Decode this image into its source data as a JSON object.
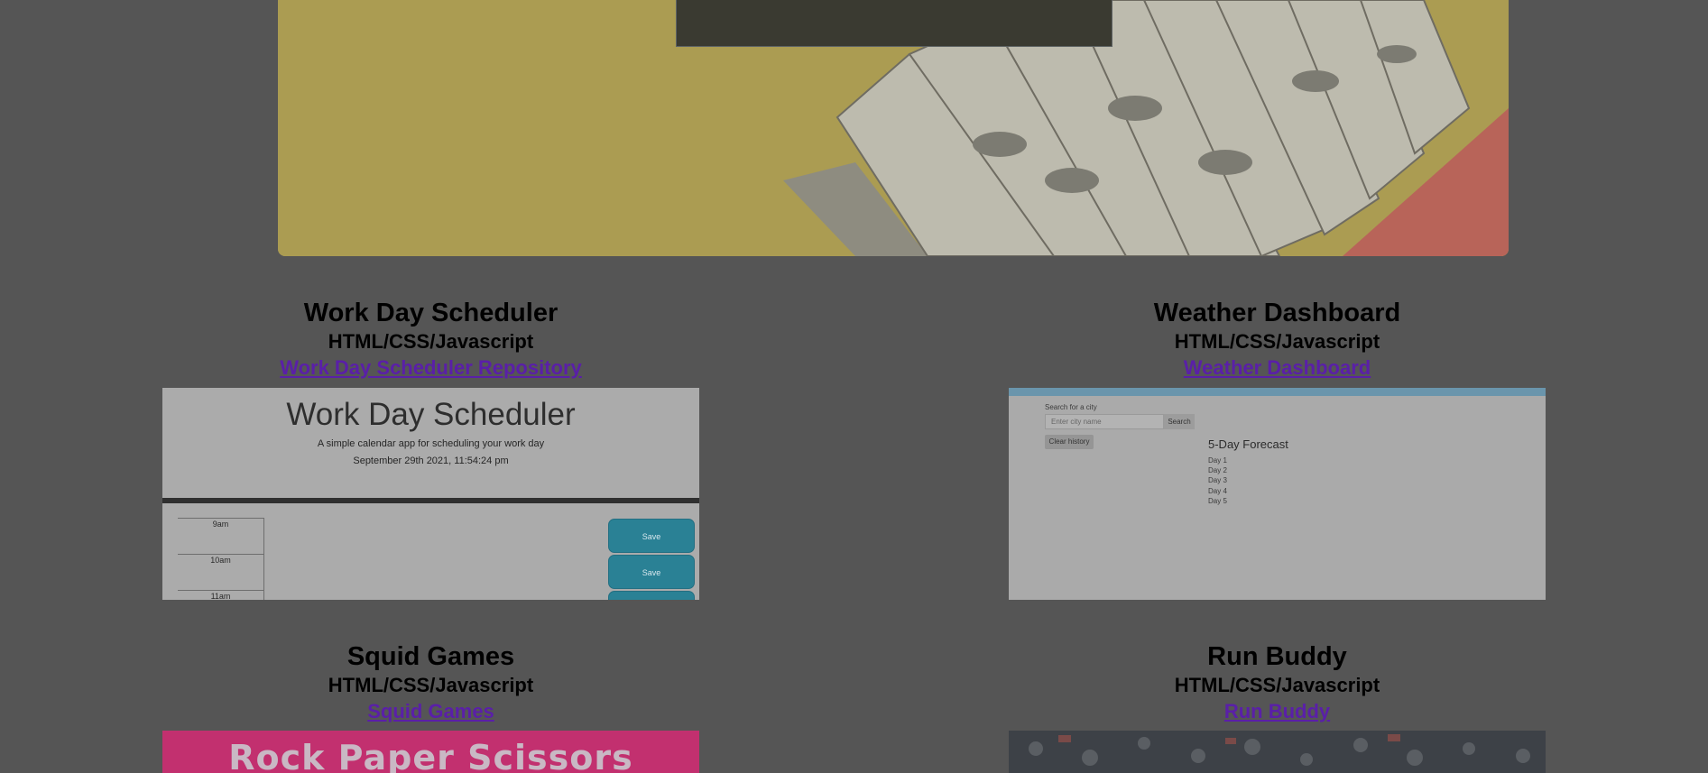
{
  "projects": [
    {
      "title": "Work Day Scheduler",
      "stack": "HTML/CSS/Javascript",
      "link": "Work Day Scheduler Repository",
      "screenshot": {
        "heading": "Work Day Scheduler",
        "subtitle": "A simple calendar app for scheduling your work day",
        "date": "September 29th 2021, 11:54:24 pm",
        "hours": [
          "9am",
          "10am",
          "11am"
        ],
        "save_label": "Save"
      }
    },
    {
      "title": "Weather Dashboard",
      "stack": "HTML/CSS/Javascript",
      "link": "Weather Dashboard",
      "screenshot": {
        "search_label": "Search for a city",
        "input_placeholder": "Enter city name",
        "search_button": "Search",
        "clear_button": "Clear history",
        "forecast_title": "5-Day Forecast",
        "days": [
          "Day 1",
          "Day 2",
          "Day 3",
          "Day 4",
          "Day 5"
        ]
      }
    },
    {
      "title": "Squid Games",
      "stack": "HTML/CSS/Javascript",
      "link": "Squid Games",
      "screenshot": {
        "banner": "Rock Paper Scissors"
      }
    },
    {
      "title": "Run Buddy",
      "stack": "HTML/CSS/Javascript",
      "link": "Run Buddy",
      "screenshot": {}
    }
  ],
  "colors": {
    "page_bg": "#555555",
    "link": "#5a1fa8",
    "save_button": "#2a8195",
    "squid_banner": "#c2306f"
  }
}
